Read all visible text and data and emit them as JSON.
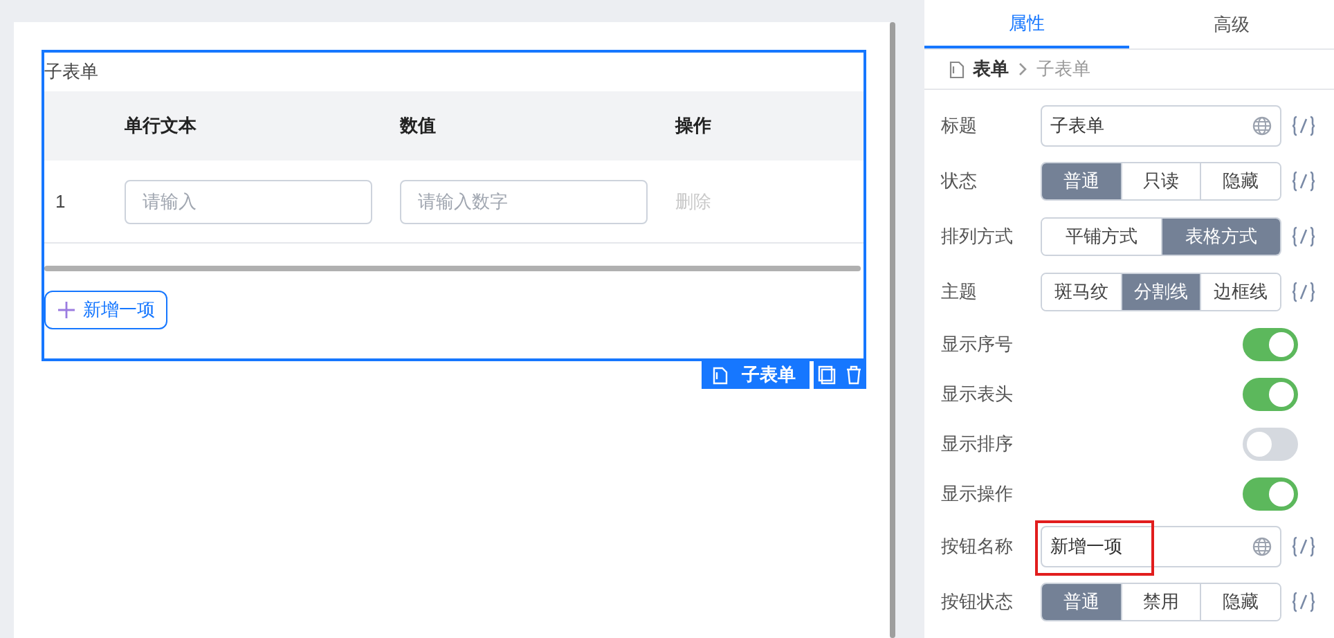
{
  "canvas": {
    "subform": {
      "title": "子表单",
      "columns": [
        "单行文本",
        "数值",
        "操作"
      ],
      "rows": [
        {
          "index": "1",
          "text_placeholder": "请输入",
          "number_placeholder": "请输入数字",
          "action": "删除"
        }
      ],
      "add_button": "新增一项",
      "selected_label": "子表单"
    }
  },
  "panel": {
    "tabs": [
      {
        "label": "属性",
        "selected": true
      },
      {
        "label": "高级",
        "selected": false
      }
    ],
    "breadcrumb": [
      "表单",
      "子表单"
    ],
    "properties": [
      {
        "kind": "text",
        "label": "标题",
        "value": "子表单",
        "highlighted": false
      },
      {
        "kind": "segmented",
        "label": "状态",
        "options": [
          {
            "label": "普通",
            "selected": true
          },
          {
            "label": "只读",
            "selected": false
          },
          {
            "label": "隐藏",
            "selected": false
          }
        ]
      },
      {
        "kind": "segmented",
        "label": "排列方式",
        "options": [
          {
            "label": "平铺方式",
            "selected": false
          },
          {
            "label": "表格方式",
            "selected": true
          }
        ]
      },
      {
        "kind": "segmented",
        "label": "主题",
        "options": [
          {
            "label": "斑马纹",
            "selected": false
          },
          {
            "label": "分割线",
            "selected": true
          },
          {
            "label": "边框线",
            "selected": false
          }
        ]
      },
      {
        "kind": "switch",
        "label": "显示序号",
        "on": true
      },
      {
        "kind": "switch",
        "label": "显示表头",
        "on": true
      },
      {
        "kind": "switch",
        "label": "显示排序",
        "on": false
      },
      {
        "kind": "switch",
        "label": "显示操作",
        "on": true
      },
      {
        "kind": "text",
        "label": "按钮名称",
        "value": "新增一项",
        "highlighted": true
      },
      {
        "kind": "segmented",
        "label": "按钮状态",
        "options": [
          {
            "label": "普通",
            "selected": true
          },
          {
            "label": "禁用",
            "selected": false
          },
          {
            "label": "隐藏",
            "selected": false
          }
        ]
      }
    ]
  }
}
